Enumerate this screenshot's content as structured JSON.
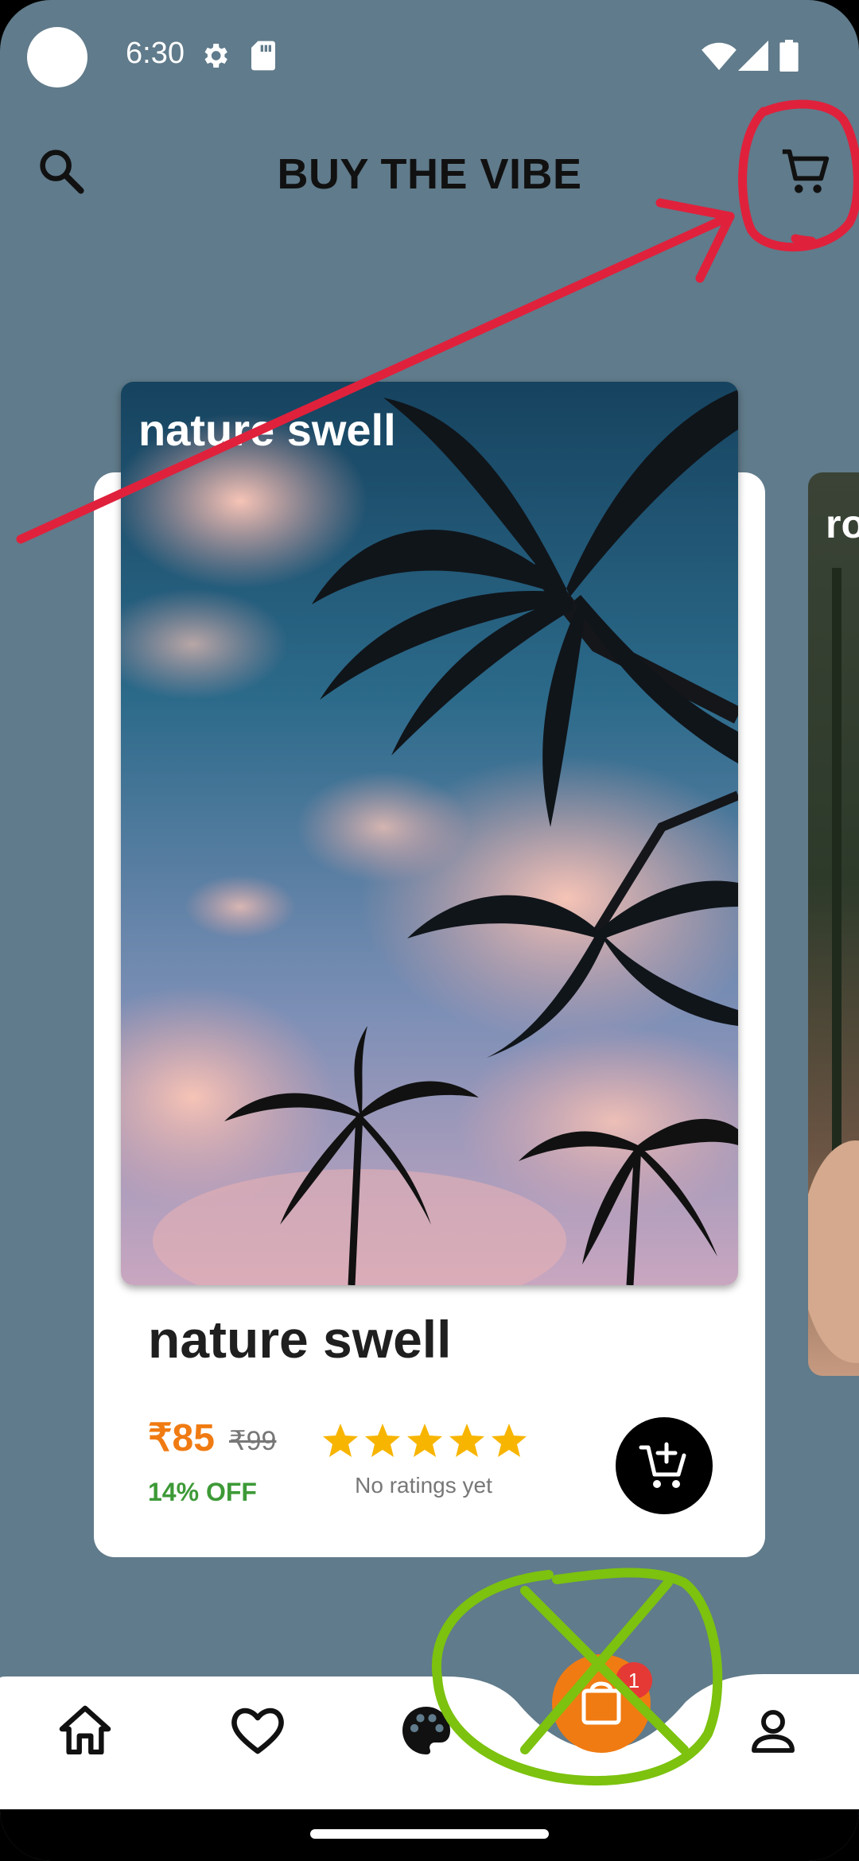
{
  "status_bar": {
    "time": "6:30"
  },
  "app": {
    "title": "BUY THE VIBE"
  },
  "product": {
    "image_label": "nature swell",
    "name": "nature swell",
    "price": "₹85",
    "original_price": "₹99",
    "discount": "14% OFF",
    "rating_count_text": "No ratings yet",
    "stars": 5
  },
  "next_product": {
    "image_label": "ro"
  },
  "bottom_nav": {
    "items": [
      {
        "icon": "home-icon"
      },
      {
        "icon": "heart-icon"
      },
      {
        "icon": "palette-icon"
      },
      {
        "icon": "bag-icon",
        "badge": "1"
      },
      {
        "icon": "person-icon"
      }
    ]
  },
  "colors": {
    "background": "#607b8b",
    "accent": "#f07b12",
    "discount": "#3d9a37",
    "star": "#f7b500",
    "badge": "#e53935",
    "annotation_red": "#e0213c",
    "annotation_green": "#7cc20e"
  }
}
